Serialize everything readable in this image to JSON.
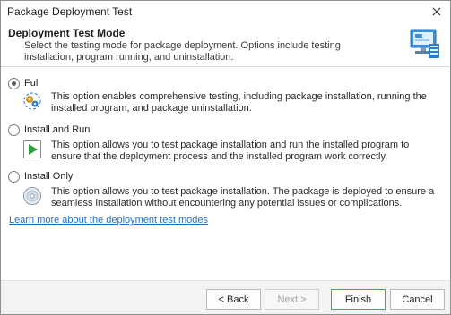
{
  "window": {
    "title": "Package Deployment Test"
  },
  "header": {
    "title": "Deployment Test Mode",
    "description": "Select the testing mode for package deployment. Options include testing installation, program running, and uninstallation."
  },
  "options": [
    {
      "label": "Full",
      "checked": true,
      "icon": "cogs-icon",
      "description": "This option enables comprehensive testing, including package installation, running the installed program, and package uninstallation."
    },
    {
      "label": "Install and Run",
      "checked": false,
      "icon": "play-icon",
      "description": "This option allows you to test package installation and run the installed program to ensure that the deployment process and the installed program work correctly."
    },
    {
      "label": "Install Only",
      "checked": false,
      "icon": "disc-icon",
      "description": "This option allows you to test package installation. The package is deployed to ensure a seamless installation without encountering any potential issues or complications."
    }
  ],
  "link": {
    "text": "Learn more about the deployment test modes"
  },
  "footer": {
    "back_label": "< Back",
    "next_label": "Next >",
    "finish_label": "Finish",
    "cancel_label": "Cancel"
  },
  "colors": {
    "accent": "#1f6fc5",
    "play_green": "#2e9e3e",
    "link": "#1f6fc5"
  }
}
